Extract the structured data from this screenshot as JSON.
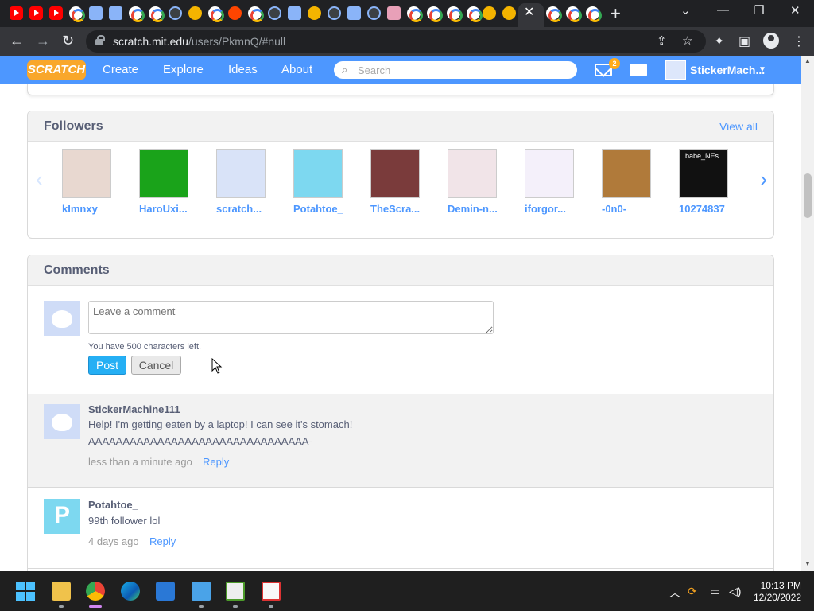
{
  "browser": {
    "url_host": "scratch.mit.edu",
    "url_path": "/users/PkmnQ/#null",
    "active_tab_close": "✕",
    "new_tab": "+"
  },
  "nav": {
    "logo": "SCRATCH",
    "create": "Create",
    "explore": "Explore",
    "ideas": "Ideas",
    "about": "About",
    "search_placeholder": "Search",
    "message_count": "2",
    "username": "StickerMach..."
  },
  "followers": {
    "title": "Followers",
    "view_all": "View all",
    "items": [
      {
        "name": "kImnxy",
        "color": "#e8d8d0"
      },
      {
        "name": "HaroUxi...",
        "color": "#1aa31a"
      },
      {
        "name": "scratch...",
        "color": "#d9e3f8"
      },
      {
        "name": "Potahtoe_",
        "color": "#7dd8f0"
      },
      {
        "name": "TheScra...",
        "color": "#7a3b3b"
      },
      {
        "name": "Demin-n...",
        "color": "#f1e4e8"
      },
      {
        "name": "iforgor...",
        "color": "#f4f0fa"
      },
      {
        "name": "-0n0-",
        "color": "#b07a3a"
      },
      {
        "name": "10274837",
        "color": "#111111"
      }
    ],
    "tile_caption": "babe_NEs"
  },
  "comments": {
    "title": "Comments",
    "placeholder": "Leave a comment",
    "chars_left": "You have 500 characters left.",
    "post": "Post",
    "cancel": "Cancel",
    "reply_label": "Reply",
    "items": [
      {
        "author": "StickerMachine111",
        "line1": "Help! I'm getting eaten by a laptop! I can see it's stomach!",
        "line2": "AAAAAAAAAAAAAAAAAAAAAAAAAAAAAAAA-",
        "time": "less than a minute ago"
      },
      {
        "author": "Potahtoe_",
        "line1": "99th follower lol",
        "time": "4 days ago"
      }
    ]
  },
  "taskbar": {
    "time": "10:13 PM",
    "date": "12/20/2022"
  }
}
